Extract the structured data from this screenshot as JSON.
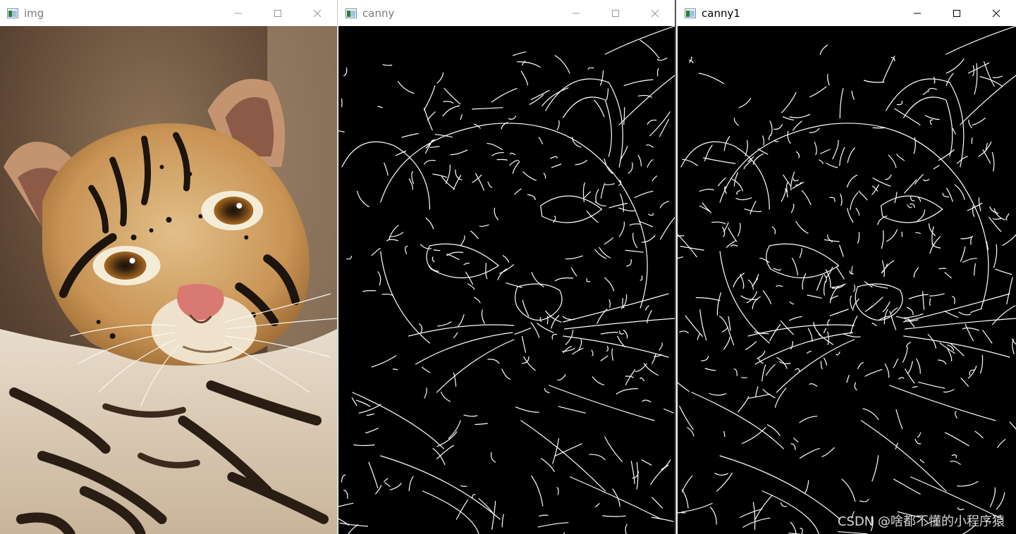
{
  "windows": [
    {
      "title": "img",
      "active": false
    },
    {
      "title": "canny",
      "active": false
    },
    {
      "title": "canny1",
      "active": true
    }
  ],
  "controls": {
    "minimize": "minimize-icon",
    "maximize": "maximize-icon",
    "close": "close-icon"
  },
  "colors": {
    "titlebar": "#ffffff",
    "inactive_glyph": "#999999",
    "active_glyph": "#000000",
    "edge_background": "#000000",
    "edge_lines": "#ffffff"
  },
  "watermark": "CSDN @啥都不懂的小程序猿"
}
